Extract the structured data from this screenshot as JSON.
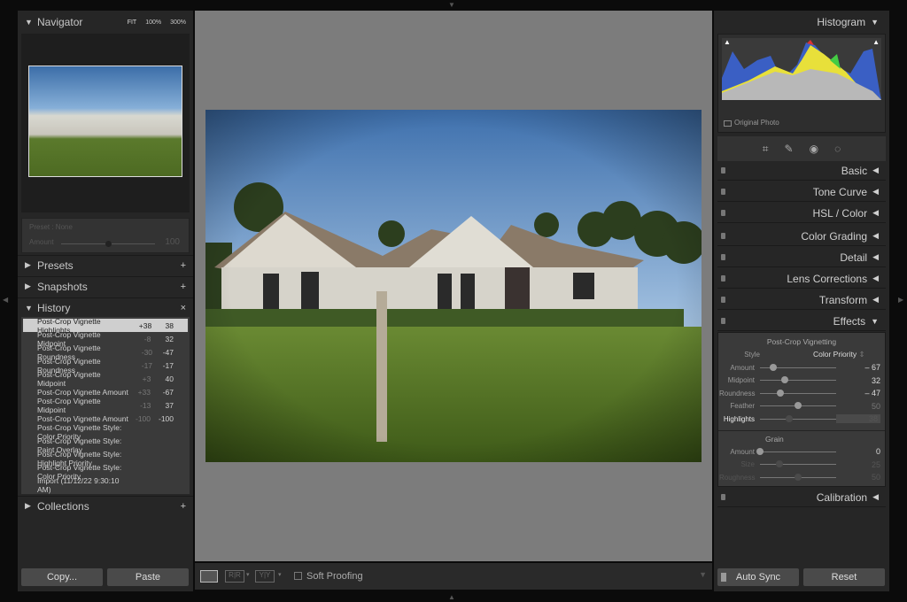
{
  "navigator": {
    "title": "Navigator",
    "zoom_options": [
      "FIT",
      "100%",
      "300%"
    ]
  },
  "preset_box": {
    "preset_label": "Preset : None",
    "amount_label": "Amount",
    "amount_value": "100",
    "amount_level": 0.5
  },
  "left_sections": {
    "presets": "Presets",
    "snapshots": "Snapshots",
    "history": "History",
    "collections": "Collections"
  },
  "history": [
    {
      "name": "Post-Crop Vignette Highlights",
      "delta": "+38",
      "value": "38"
    },
    {
      "name": "Post-Crop Vignette Midpoint",
      "delta": "-8",
      "value": "32"
    },
    {
      "name": "Post-Crop Vignette Roundness",
      "delta": "-30",
      "value": "-47"
    },
    {
      "name": "Post-Crop Vignette Roundness",
      "delta": "-17",
      "value": "-17"
    },
    {
      "name": "Post-Crop Vignette Midpoint",
      "delta": "+3",
      "value": "40"
    },
    {
      "name": "Post-Crop Vignette Amount",
      "delta": "+33",
      "value": "-67"
    },
    {
      "name": "Post-Crop Vignette Midpoint",
      "delta": "-13",
      "value": "37"
    },
    {
      "name": "Post-Crop Vignette Amount",
      "delta": "-100",
      "value": "-100"
    },
    {
      "name": "Post-Crop Vignette Style: Color Priority",
      "delta": "",
      "value": ""
    },
    {
      "name": "Post-Crop Vignette Style: Paint Overlay",
      "delta": "",
      "value": ""
    },
    {
      "name": "Post-Crop Vignette Style: Highlight Priority",
      "delta": "",
      "value": ""
    },
    {
      "name": "Post-Crop Vignette Style: Color Priority",
      "delta": "",
      "value": ""
    },
    {
      "name": "Import (11/12/22 9:30:10 AM)",
      "delta": "",
      "value": ""
    }
  ],
  "left_buttons": {
    "copy": "Copy...",
    "paste": "Paste"
  },
  "toolbar": {
    "soft_proofing": "Soft Proofing"
  },
  "histogram": {
    "title": "Histogram",
    "original_photo": "Original Photo"
  },
  "right_sections": [
    "Basic",
    "Tone Curve",
    "HSL / Color",
    "Color Grading",
    "Detail",
    "Lens Corrections",
    "Transform",
    "Effects",
    "Calibration"
  ],
  "effects": {
    "vignette_title": "Post-Crop Vignetting",
    "style_label": "Style",
    "style_value": "Color Priority",
    "sliders": [
      {
        "label": "Amount",
        "value": "– 67",
        "level": 0.17
      },
      {
        "label": "Midpoint",
        "value": "32",
        "level": 0.32
      },
      {
        "label": "Roundness",
        "value": "– 47",
        "level": 0.27
      },
      {
        "label": "Feather",
        "value": "50",
        "level": 0.5
      },
      {
        "label": "Highlights",
        "value": "38",
        "level": 0.38
      }
    ],
    "grain_title": "Grain",
    "grain": [
      {
        "label": "Amount",
        "value": "0",
        "level": 0
      },
      {
        "label": "Size",
        "value": "25",
        "level": 0.25
      },
      {
        "label": "Roughness",
        "value": "50",
        "level": 0.5
      }
    ]
  },
  "right_buttons": {
    "auto_sync": "Auto Sync",
    "reset": "Reset"
  }
}
